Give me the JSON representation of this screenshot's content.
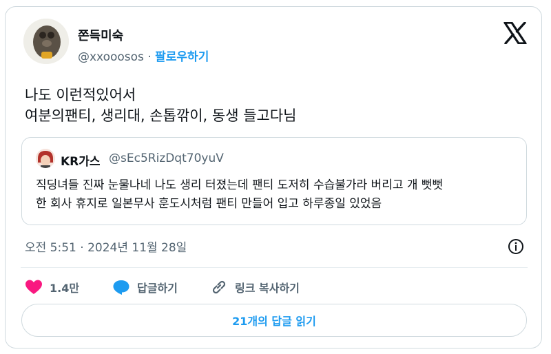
{
  "author": {
    "name": "쫀득미숙",
    "handle": "@xxooosos",
    "separator": " · ",
    "follow_label": "팔로우하기"
  },
  "post": {
    "lines": [
      "나도 이런적있어서",
      "여분의팬티, 생리대, 손톱깎이, 동생 들고다님"
    ]
  },
  "quote": {
    "name": "KR가스",
    "handle": "@sEc5RizDqt70yuV",
    "lines": [
      "직딩녀들 진짜 눈물나네 나도 생리 터졌는데 팬티 도저히 수습불가라 버리고 개 뻣뻣",
      "한 회사 휴지로 일본무사 훈도시처럼 팬티 만들어 입고 하루종일 있었음"
    ]
  },
  "timestamp": "오전 5:51 · 2024년 11월 28일",
  "actions": {
    "like_count": "1.4만",
    "reply_label": "답글하기",
    "link_label": "링크 복사하기"
  },
  "read_replies_label": "21개의 답글 읽기",
  "colors": {
    "accent": "#1d9bf0",
    "like": "#f91880",
    "secondary_text": "#536471",
    "border": "#cfd9de"
  },
  "icons": [
    "x-logo-icon",
    "info-icon",
    "heart-icon",
    "speech-bubble-icon",
    "link-icon"
  ]
}
